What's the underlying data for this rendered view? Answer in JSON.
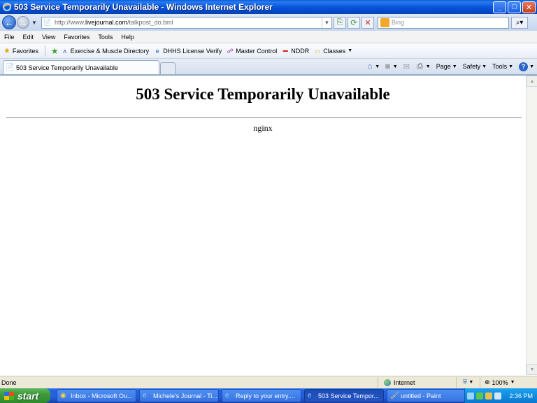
{
  "window": {
    "title": "503 Service Temporarily Unavailable - Windows Internet Explorer",
    "minimize_label": "_",
    "maximize_label": "□",
    "close_label": "✕"
  },
  "address_bar": {
    "url_prefix": "http://www.",
    "url_domain": "livejournal.com",
    "url_path": "/talkpost_do.bml"
  },
  "search": {
    "placeholder": "Bing"
  },
  "menu": [
    "File",
    "Edit",
    "View",
    "Favorites",
    "Tools",
    "Help"
  ],
  "favorites_bar": {
    "favorites_label": "Favorites",
    "items": [
      "Exercise & Muscle Directory",
      "DHHS License Verify",
      "Master Control",
      "NDDR",
      "Classes"
    ]
  },
  "tab": {
    "title": "503 Service Temporarily Unavailable"
  },
  "command_bar": {
    "page_label": "Page",
    "safety_label": "Safety",
    "tools_label": "Tools"
  },
  "page": {
    "heading": "503 Service Temporarily Unavailable",
    "server": "nginx"
  },
  "status_bar": {
    "status": "Done",
    "zone": "Internet",
    "zoom": "100%"
  },
  "taskbar": {
    "start_label": "start",
    "tasks": [
      "Inbox - Microsoft Ou...",
      "Michele's Journal - Ti...",
      "Reply to your entry....",
      "503 Service Tempor...",
      "untitled - Paint"
    ],
    "active_task_index": 3,
    "clock": "2:36 PM"
  },
  "colors": {
    "titlebar_blue": "#0855dd",
    "taskbar_blue": "#245edb",
    "start_green": "#3c9b3a"
  }
}
